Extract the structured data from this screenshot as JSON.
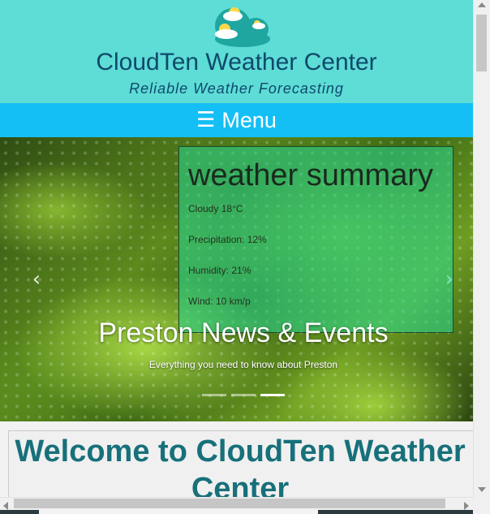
{
  "header": {
    "title": "CloudTen Weather Center",
    "tagline": "Reliable Weather Forecasting",
    "logo_icon": "cloud-sun-logo-icon"
  },
  "menu": {
    "icon": "hamburger-icon",
    "icon_glyph": "☰",
    "label": "Menu"
  },
  "carousel": {
    "prev_glyph": "‹",
    "next_glyph": "›",
    "caption_title": "Preston News & Events",
    "caption_sub": "Everything you need to know about Preston",
    "active_slide": 3,
    "slide_count": 3
  },
  "weather_summary": {
    "title": "weather summary",
    "condition": "Cloudy 18°C",
    "precipitation": "Precipitation: 12%",
    "humidity": "Humidity: 21%",
    "wind": "Wind: 10 km/p"
  },
  "welcome": {
    "title": "Welcome to CloudTen Weather Center"
  },
  "colors": {
    "header_bg": "#5edcd6",
    "menu_bg": "#14bff5",
    "title_text": "#0e4a6c",
    "welcome_text": "#17707a",
    "summary_panel": "#28dc96"
  }
}
